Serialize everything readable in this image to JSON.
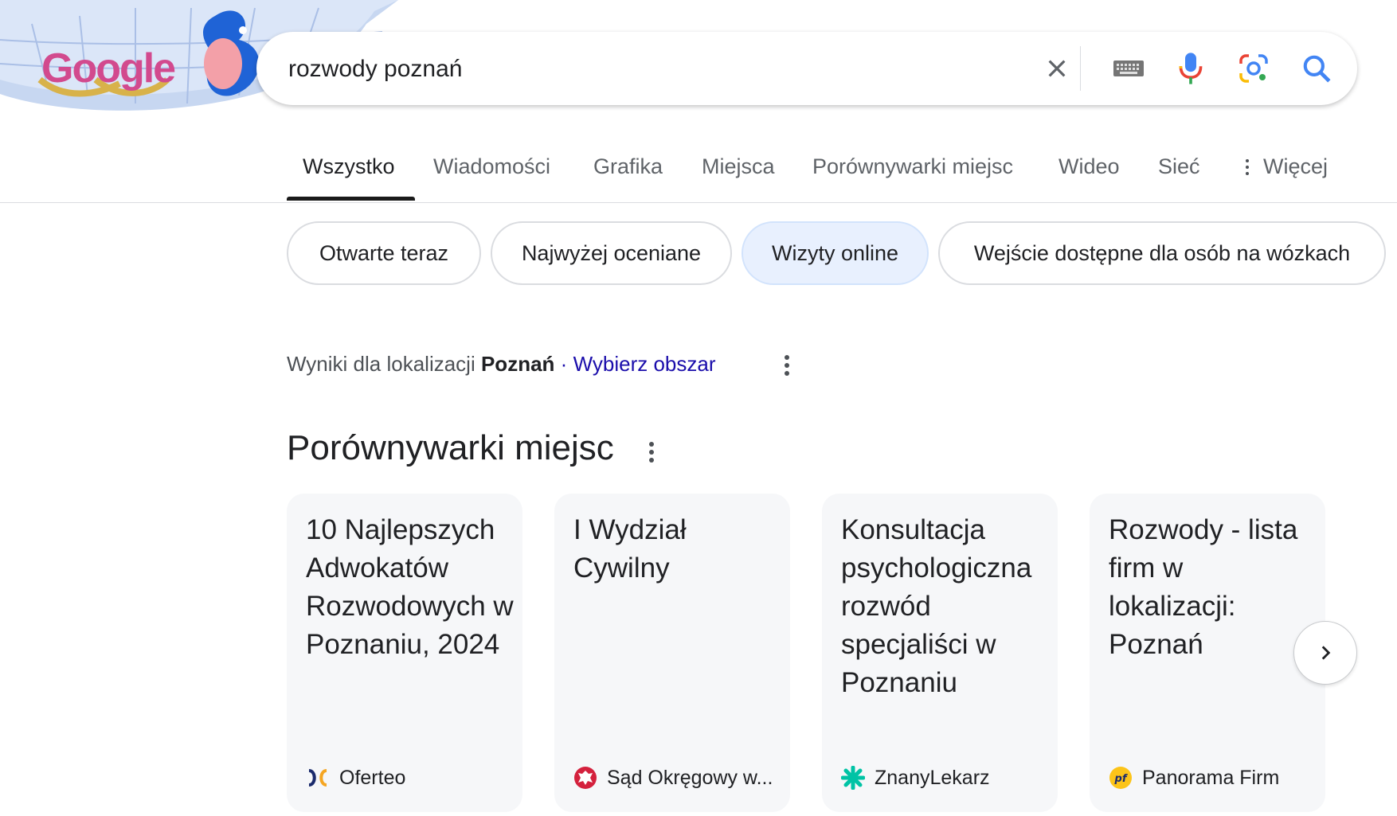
{
  "search": {
    "query": "rozwody poznań"
  },
  "logo": {
    "text": "Google"
  },
  "tabs": [
    {
      "label": "Wszystko"
    },
    {
      "label": "Wiadomości"
    },
    {
      "label": "Grafika"
    },
    {
      "label": "Miejsca"
    },
    {
      "label": "Porównywarki miejsc"
    },
    {
      "label": "Wideo"
    },
    {
      "label": "Sieć"
    },
    {
      "label": "Więcej"
    }
  ],
  "active_tab": "Wszystko",
  "chips": [
    {
      "label": "Otwarte teraz"
    },
    {
      "label": "Najwyżej oceniane"
    },
    {
      "label": "Wizyty online"
    },
    {
      "label": "Wejście dostępne dla osób na wózkach"
    }
  ],
  "selected_chip": "Wizyty online",
  "location": {
    "prefix": "Wyniki dla lokalizacji",
    "place": "Poznań",
    "separator": "·",
    "link": "Wybierz obszar"
  },
  "section": {
    "title": "Porównywarki miejsc"
  },
  "cards": [
    {
      "title": "10 Najlepszych Adwokatów Rozwodowych w Poznaniu, 2024",
      "source": "Oferteo",
      "icon": "oferteo-logo-icon"
    },
    {
      "title": "I Wydział Cywilny",
      "source": "Sąd Okręgowy w...",
      "icon": "polish-eagle-emblem-icon"
    },
    {
      "title": "Konsultacja psychologiczna rozwód specjaliści w Poznaniu",
      "source": "ZnanyLekarz",
      "icon": "znanylekarz-logo-icon"
    },
    {
      "title": "Rozwody - lista firm w lokalizacji: Poznań",
      "source": "Panorama Firm",
      "icon": "panorama-firm-logo-icon"
    }
  ],
  "colors": {
    "accent_blue": "#1a73e8",
    "link": "#1a0dab",
    "chip_selected_bg": "#e8f0fe",
    "card_bg": "#f6f7f9"
  }
}
